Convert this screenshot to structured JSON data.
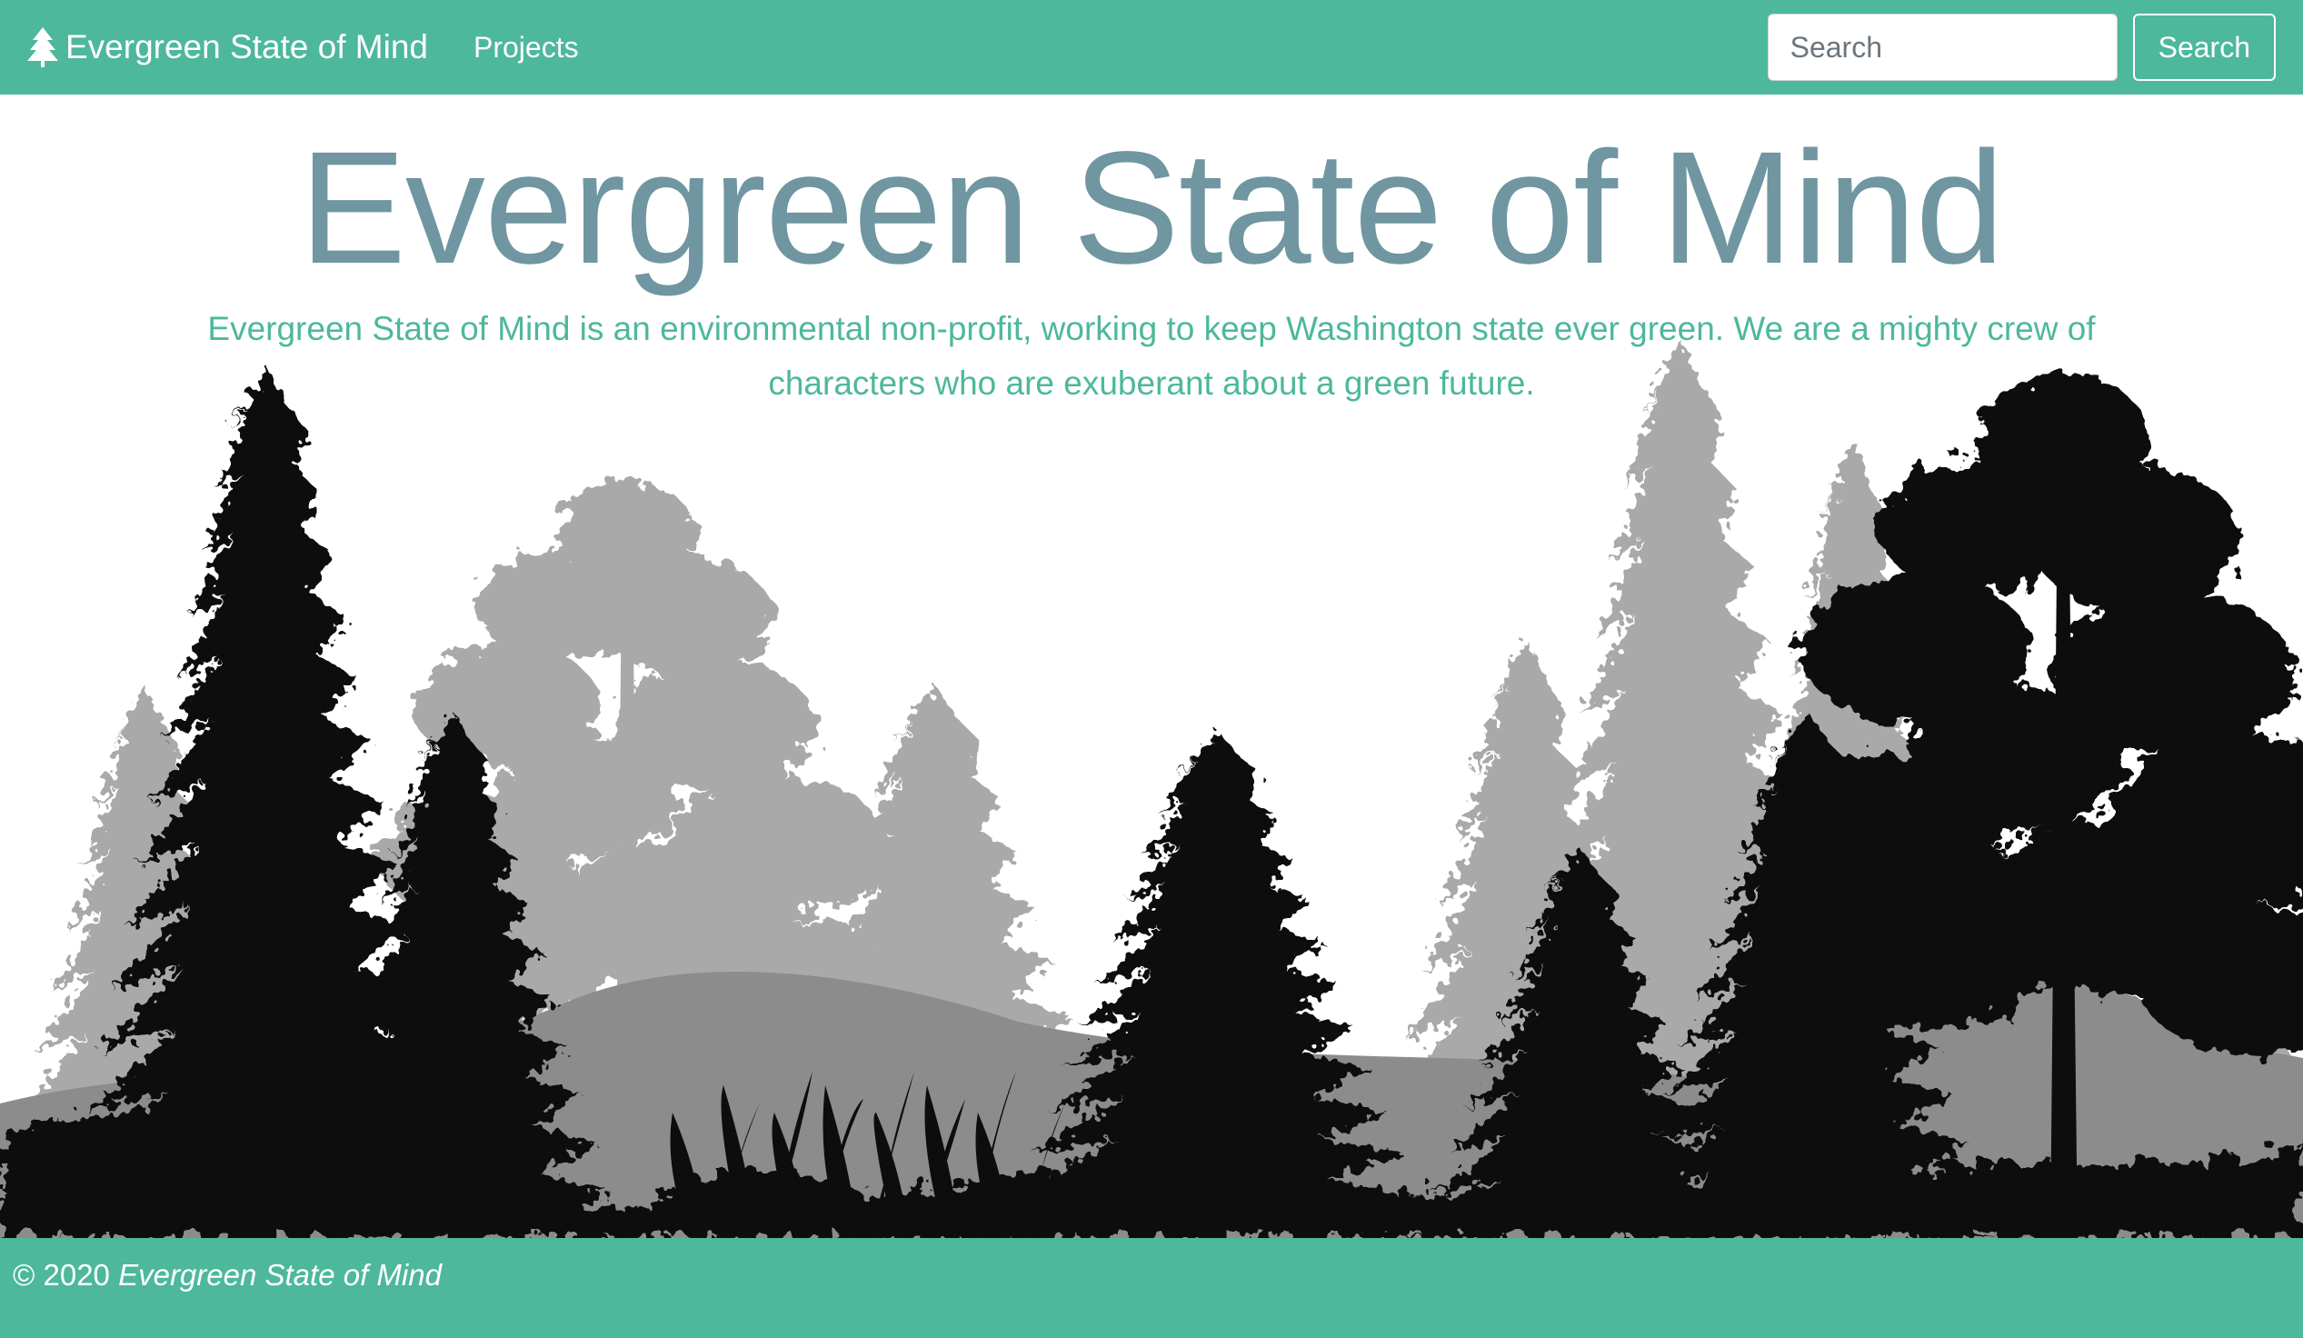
{
  "navbar": {
    "brand_icon": "tree-icon",
    "brand_text": "Evergreen State of Mind",
    "links": [
      "Projects"
    ],
    "search_placeholder": "Search",
    "search_button": "Search"
  },
  "hero": {
    "title": "Evergreen State of Mind",
    "description": "Evergreen State of Mind is an environmental non-profit, working to keep Washington state ever green. We are a mighty crew of characters who are exuberant about a green future.",
    "background_image": "forest-silhouette"
  },
  "footer": {
    "copyright": "© 2020",
    "org_name": "Evergreen State of Mind"
  },
  "colors": {
    "brand": "#4db89b",
    "title": "#6f96a1",
    "text_light": "#ffffff"
  }
}
